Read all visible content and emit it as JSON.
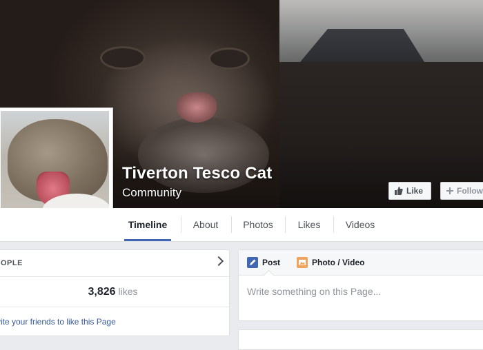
{
  "page": {
    "name": "Tiverton Tesco Cat",
    "category": "Community"
  },
  "actions": {
    "like_label": "Like",
    "follow_label": "Follow"
  },
  "tabs": [
    {
      "label": "Timeline",
      "active": true
    },
    {
      "label": "About",
      "active": false
    },
    {
      "label": "Photos",
      "active": false
    },
    {
      "label": "Likes",
      "active": false
    },
    {
      "label": "Videos",
      "active": false
    }
  ],
  "people_card": {
    "title": "OPLE",
    "likes_count": "3,826",
    "likes_word": "likes",
    "invite_text": "vite your friends to like this Page"
  },
  "composer": {
    "post_label": "Post",
    "photo_label": "Photo / Video",
    "placeholder": "Write something on this Page..."
  },
  "colors": {
    "accent": "#4267b2",
    "link": "#365899"
  },
  "icons": {
    "like": "thumbs-up-icon",
    "follow": "plus-icon",
    "post": "pencil-icon",
    "photo": "photo-icon",
    "chevron": "chevron-right-icon"
  }
}
